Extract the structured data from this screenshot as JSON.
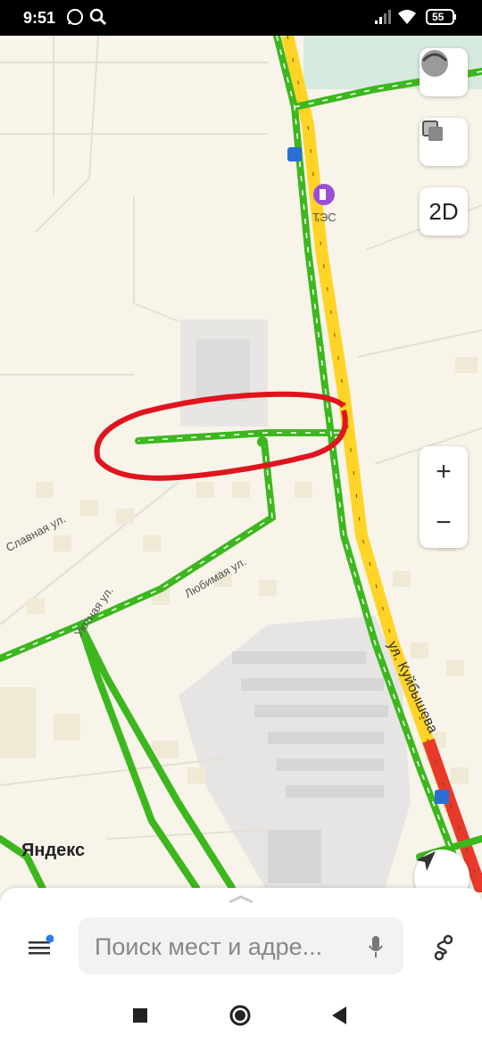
{
  "status": {
    "time": "9:51",
    "battery": "55",
    "icons": [
      "whatsapp-icon",
      "search-icon",
      "signal-icon",
      "wifi-icon",
      "battery-icon"
    ]
  },
  "map": {
    "labels": {
      "tes": "ТЭС",
      "slavnaya": "Славная ул.",
      "lyubimaya": "Любимая ул.",
      "uyutnaya": "Уютная ул.",
      "kuybysheva": "ул. Куйбышева",
      "yandex": "Яндекс"
    },
    "controls": {
      "mode": "2D",
      "zoom_in": "+",
      "zoom_out": "−"
    },
    "colors": {
      "road_green": "#3cb81e",
      "road_yellow": "#ffd426",
      "road_red": "#e8392b",
      "annotation": "#e0141d"
    }
  },
  "search": {
    "placeholder": "Поиск мест и адре..."
  },
  "navbar": {
    "icons": [
      "square-icon",
      "circle-icon",
      "back-triangle-icon"
    ]
  }
}
